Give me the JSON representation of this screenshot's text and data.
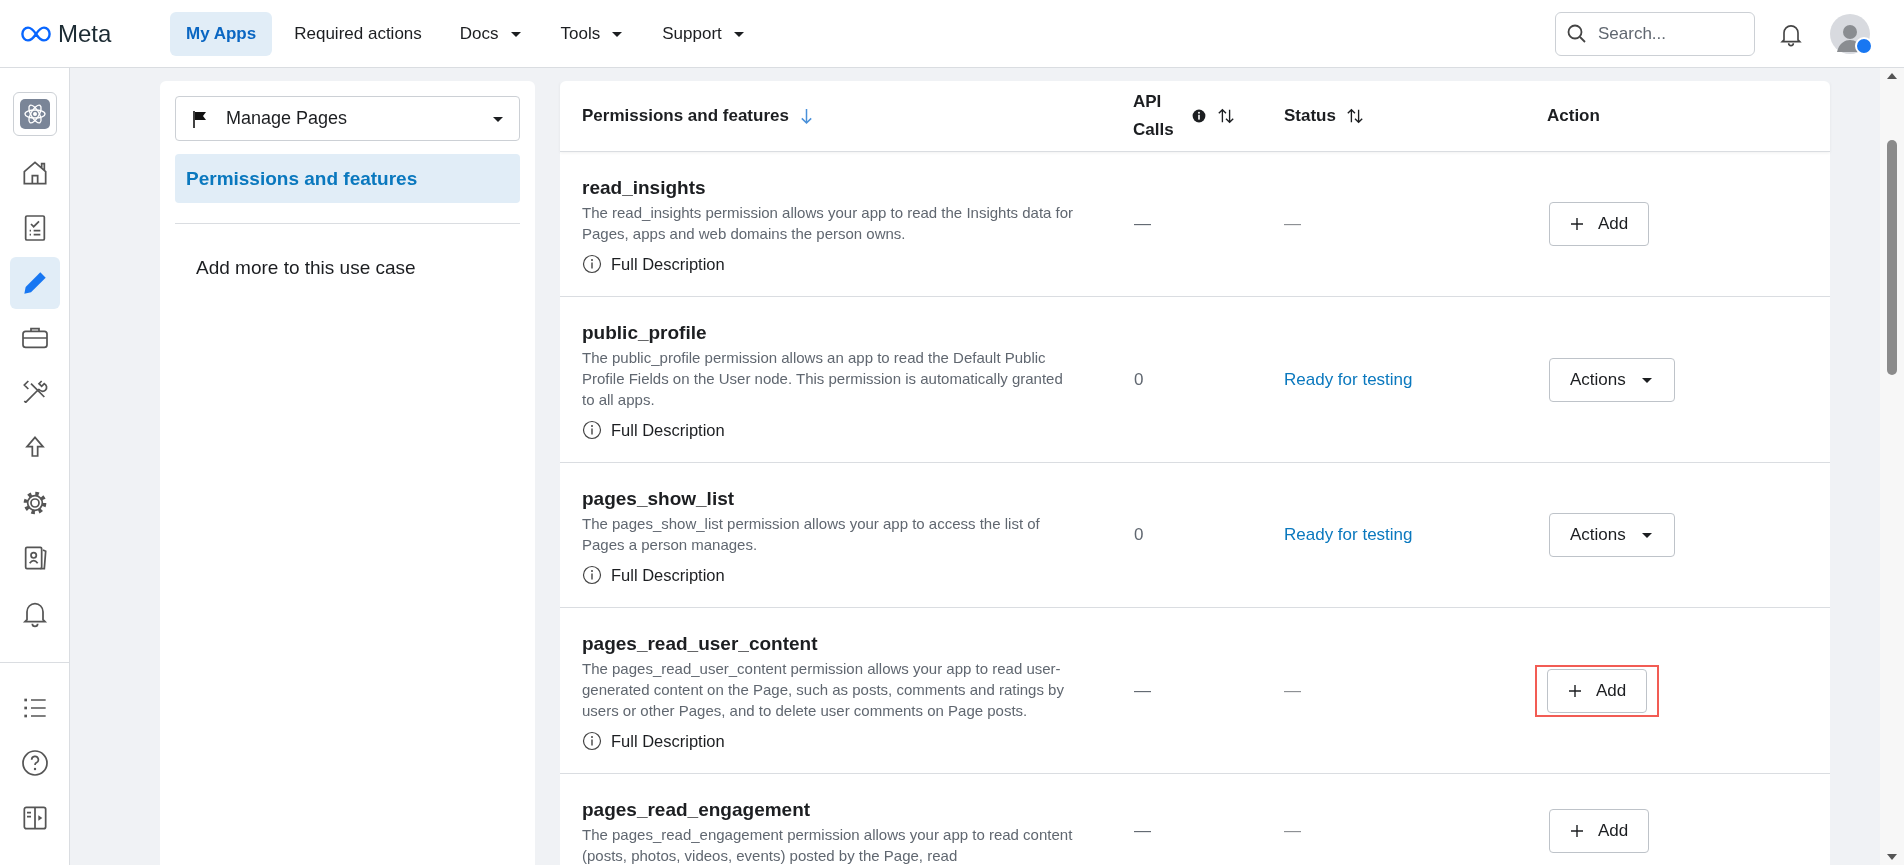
{
  "top_bar": {
    "logo": "Meta",
    "nav": [
      {
        "label": "My Apps",
        "selected": true,
        "has_menu": false
      },
      {
        "label": "Required actions",
        "selected": false,
        "has_menu": false
      },
      {
        "label": "Docs",
        "selected": false,
        "has_menu": true
      },
      {
        "label": "Tools",
        "selected": false,
        "has_menu": true
      },
      {
        "label": "Support",
        "selected": false,
        "has_menu": true
      }
    ],
    "search": {
      "placeholder": "Search..."
    }
  },
  "rail": {
    "items": [
      {
        "selected": false
      },
      {
        "selected": false
      },
      {
        "selected": true
      },
      {
        "selected": false
      },
      {
        "selected": false
      },
      {
        "selected": false
      },
      {
        "selected": false
      },
      {
        "selected": false
      },
      {
        "selected": false
      }
    ]
  },
  "use_case_panel": {
    "use_case": "Manage Pages",
    "menu": [
      {
        "label": "Permissions and features",
        "selected": true
      }
    ],
    "add_more": "Add more to this use case"
  },
  "table": {
    "columns": [
      {
        "label": "Permissions and features",
        "sorted": true,
        "sortable": false,
        "info": false
      },
      {
        "label": "API Calls",
        "sorted": false,
        "sortable": true,
        "info": true
      },
      {
        "label": "Status",
        "sorted": false,
        "sortable": true,
        "info": false
      },
      {
        "label": "Action",
        "sorted": false,
        "sortable": false,
        "info": false
      }
    ],
    "rows": [
      {
        "name": "read_insights",
        "description": "The read_insights permission allows your app to read the Insights data for Pages, apps and web domains the person owns.",
        "link": "Full Description",
        "api_calls": "—",
        "status": "—",
        "ready": false,
        "action": {
          "kind": "add",
          "label": "Add"
        },
        "highlighted": false
      },
      {
        "name": "public_profile",
        "description": "The public_profile permission allows an app to read the Default Public Profile Fields on the User node. This permission is automatically granted to all apps.",
        "link": "Full Description",
        "api_calls": "0",
        "status": "Ready for testing",
        "ready": true,
        "action": {
          "kind": "menu",
          "label": "Actions"
        },
        "highlighted": false
      },
      {
        "name": "pages_show_list",
        "description": "The pages_show_list permission allows your app to access the list of Pages a person manages.",
        "link": "Full Description",
        "api_calls": "0",
        "status": "Ready for testing",
        "ready": true,
        "action": {
          "kind": "menu",
          "label": "Actions"
        },
        "highlighted": false
      },
      {
        "name": "pages_read_user_content",
        "description": "The pages_read_user_content permission allows your app to read user-generated content on the Page, such as posts, comments and ratings by users or other Pages, and to delete user comments on Page posts.",
        "link": "Full Description",
        "api_calls": "—",
        "status": "—",
        "ready": false,
        "action": {
          "kind": "add",
          "label": "Add"
        },
        "highlighted": true
      },
      {
        "name": "pages_read_engagement",
        "description": "The pages_read_engagement permission allows your app to read content (posts, photos, videos, events) posted by the Page, read",
        "api_calls": "—",
        "status": "—",
        "ready": false,
        "action": {
          "kind": "add",
          "label": "Add"
        },
        "highlighted": false
      }
    ]
  }
}
